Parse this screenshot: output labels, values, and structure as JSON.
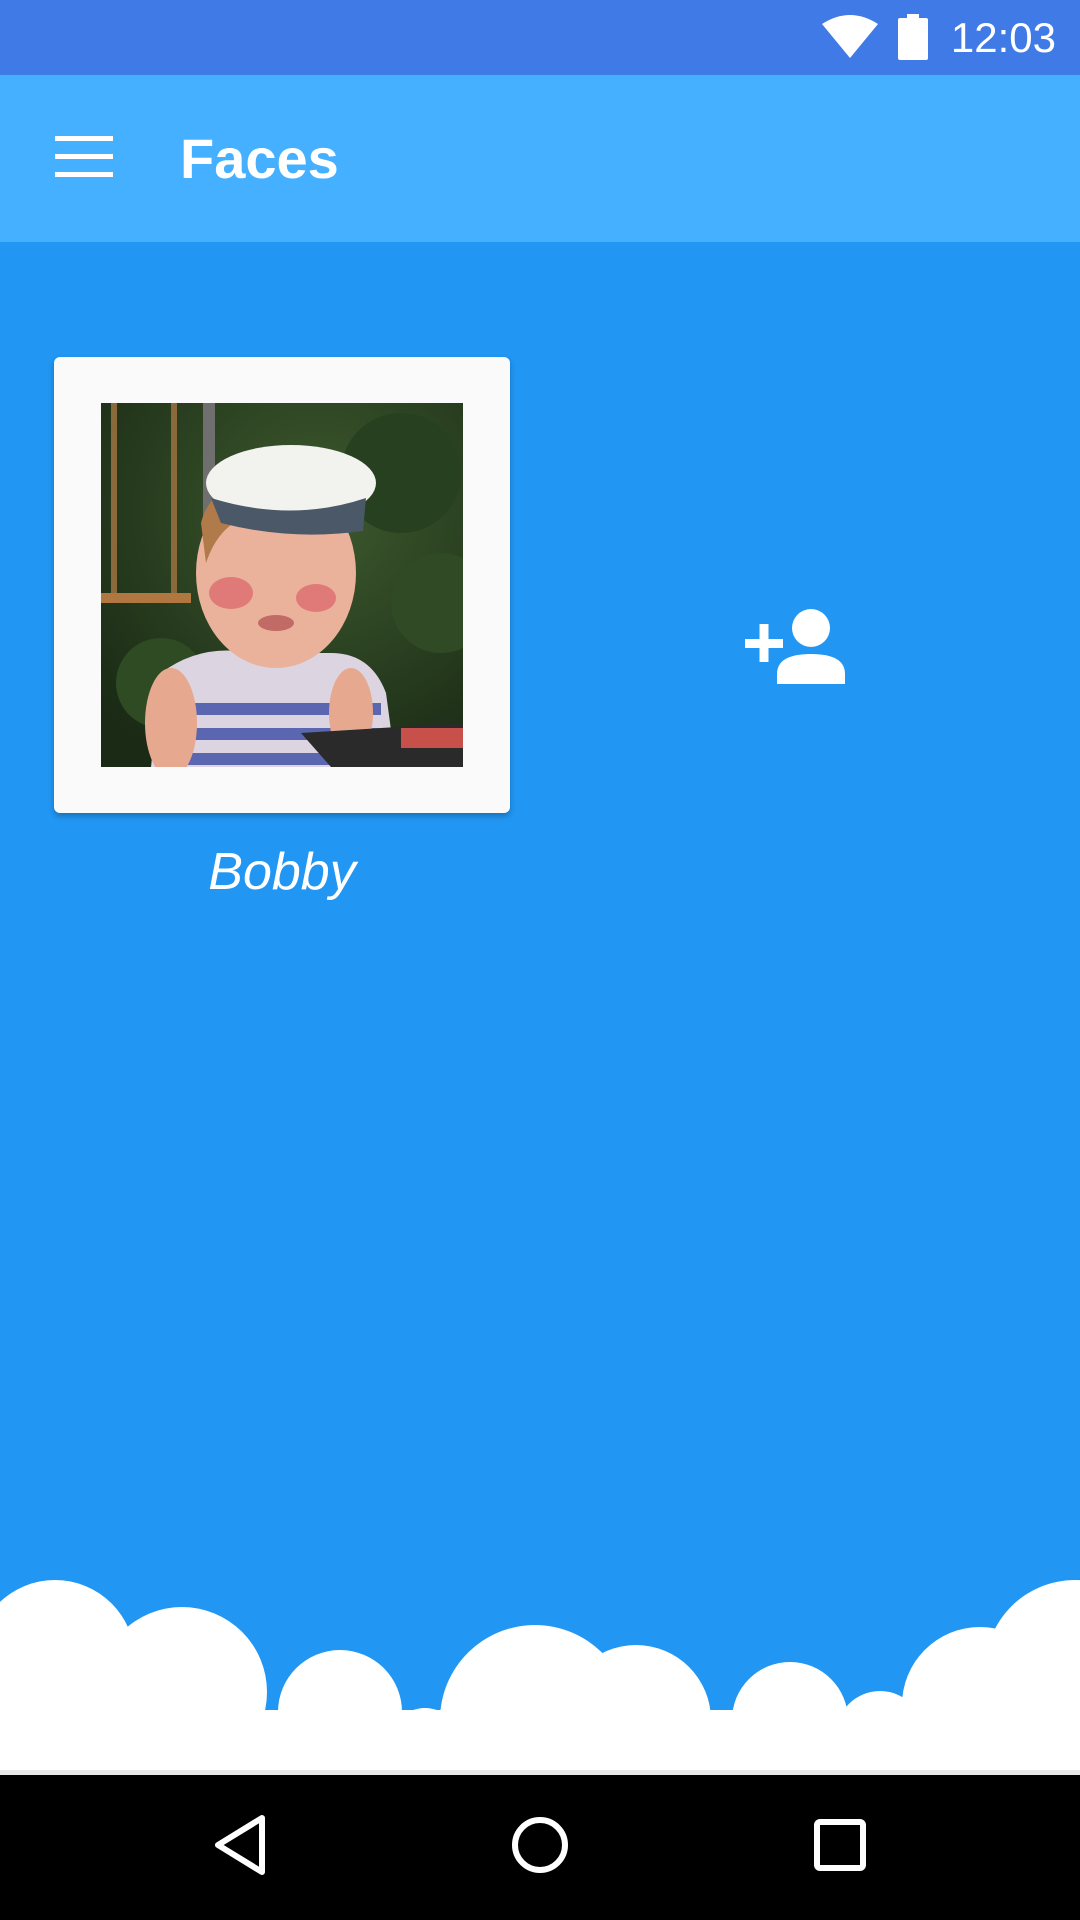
{
  "status_bar": {
    "time": "12:03",
    "icons": [
      "wifi-icon",
      "battery-icon"
    ]
  },
  "app_bar": {
    "title": "Faces",
    "menu_icon": "menu-icon"
  },
  "faces": [
    {
      "name": "Bobby"
    }
  ],
  "add_person_icon": "add-person-icon",
  "nav_bar": {
    "icons": [
      "back-icon",
      "home-icon",
      "recents-icon"
    ]
  },
  "colors": {
    "status_bar": "#3F7AE6",
    "app_bar": "#45B0FF",
    "background": "#2196F3",
    "card": "#FAFAFA",
    "nav_bar": "#000000"
  }
}
